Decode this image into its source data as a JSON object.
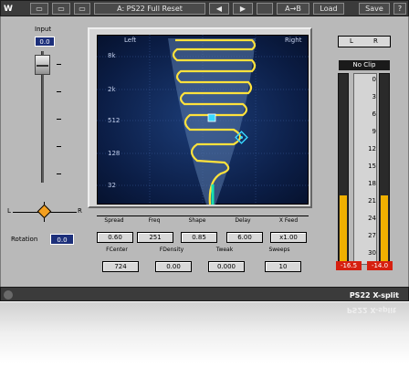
{
  "toolbar": {
    "logo": "W",
    "preset": "A: PS22 Full Reset",
    "buttons": {
      "ab": "A→B",
      "load": "Load",
      "save": "Save",
      "help": "?"
    }
  },
  "input": {
    "label": "Input",
    "value": "0.0"
  },
  "rotation": {
    "left": "L",
    "right": "R",
    "label": "Rotation",
    "value": "0.0"
  },
  "display": {
    "left_label": "Left",
    "right_label": "Right",
    "freq_labels": [
      "8k",
      "2k",
      "512",
      "128",
      "32"
    ]
  },
  "params_row1": {
    "labels": [
      "Spread",
      "Freq",
      "Shape",
      "Delay",
      "X Feed"
    ],
    "values": [
      "0.60",
      "251",
      "0.85",
      "6.00",
      "x1.00"
    ]
  },
  "params_row2": {
    "labels": [
      "FCenter",
      "FDensity",
      "Tweak",
      "Sweeps"
    ],
    "values": [
      "724",
      "0.00",
      "0.000",
      "10"
    ]
  },
  "meters": {
    "link_left": "L",
    "link_right": "R",
    "noclip": "No Clip",
    "scale": [
      "0",
      "3",
      "6",
      "9",
      "12",
      "15",
      "18",
      "21",
      "24",
      "27",
      "30"
    ],
    "left_level_percent": 36,
    "right_level_percent": 36,
    "peak_left": "-16.5",
    "peak_right": "-14.0",
    "accent_color": "#f0b000",
    "peak_color": "#d62010"
  },
  "bottombar": {
    "title": "PS22 X-split"
  }
}
